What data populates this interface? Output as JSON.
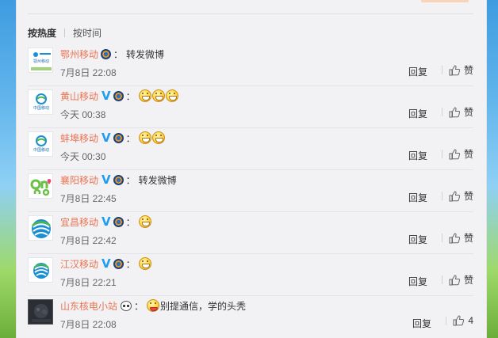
{
  "sort": {
    "hot_label": "按热度",
    "time_label": "按时间"
  },
  "actions": {
    "reply_label": "回复",
    "like_label": "赞"
  },
  "comments": [
    {
      "user": "鄂州移动",
      "avatar": "ezhou-mobile-logo",
      "avatar_text": "鄂州移动",
      "verified": false,
      "text": "转发微博",
      "emoji_count": 0,
      "time": "7月8日 22:08",
      "likes": ""
    },
    {
      "user": "黄山移动",
      "avatar": "china-mobile-logo",
      "avatar_text": "中国移动",
      "verified": true,
      "text": "",
      "emoji_count": 3,
      "time": "今天 00:38",
      "likes": ""
    },
    {
      "user": "蚌埠移动",
      "avatar": "china-mobile-logo",
      "avatar_text": "中国移动",
      "verified": true,
      "text": "",
      "emoji_count": 2,
      "time": "今天 00:30",
      "likes": ""
    },
    {
      "user": "襄阳移动",
      "avatar": "and-logo",
      "verified": true,
      "text": "转发微博",
      "emoji_count": 0,
      "time": "7月8日 22:45",
      "likes": ""
    },
    {
      "user": "宜昌移动",
      "avatar": "china-mobile-swirl-logo",
      "verified": true,
      "text": "",
      "emoji_count": 1,
      "time": "7月8日 22:42",
      "likes": ""
    },
    {
      "user": "江汉移动",
      "avatar": "china-mobile-swirl-logo",
      "verified": true,
      "text": "",
      "emoji_count": 1,
      "time": "7月8日 22:21",
      "likes": ""
    },
    {
      "user": "山东核电小站",
      "avatar": "dark-photo",
      "verified": false,
      "text": "别提通信，学的头秃",
      "emoji_count": 1,
      "time": "7月8日 22:08",
      "likes": "4"
    }
  ],
  "colors": {
    "username": "#eb7350",
    "verified_badge": "#1f9ef1",
    "panel_bg": "#f2f2f5"
  }
}
